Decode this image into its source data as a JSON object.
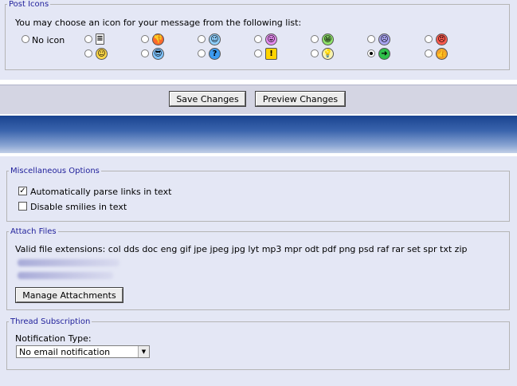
{
  "post_icons": {
    "legend": "Post Icons",
    "prompt": "You may choose an icon for your message from the following list:",
    "no_icon_label": "No icon",
    "icons": [
      {
        "name": "page-icon",
        "glyph": "≡",
        "color": "#f4f4f4"
      },
      {
        "name": "thumbs-down-icon",
        "glyph": "👎",
        "color": "#ff6a2b"
      },
      {
        "name": "wink-icon",
        "glyph": "😉",
        "color": "#8fd0ff"
      },
      {
        "name": "tongue-out-icon",
        "glyph": "😛",
        "color": "#e58bf0"
      },
      {
        "name": "grin-icon",
        "glyph": "😁",
        "color": "#8fe36a"
      },
      {
        "name": "frown-icon",
        "glyph": "☹",
        "color": "#a9a4f2"
      },
      {
        "name": "angry-icon",
        "glyph": "😠",
        "color": "#ff5b4f"
      },
      {
        "name": "smile-icon",
        "glyph": "☺",
        "color": "#ffd84a"
      },
      {
        "name": "cool-icon",
        "glyph": "😎",
        "color": "#7fc3ff"
      },
      {
        "name": "question-icon",
        "glyph": "?",
        "color": "#3c9bf0"
      },
      {
        "name": "warning-icon",
        "glyph": "!",
        "color": "#ffd400"
      },
      {
        "name": "lightbulb-icon",
        "glyph": "💡",
        "color": "#f8f3b0"
      },
      {
        "name": "arrow-right-icon",
        "glyph": "➜",
        "color": "#2fc04a"
      },
      {
        "name": "thumbs-up-icon",
        "glyph": "👍",
        "color": "#f3a32d"
      }
    ],
    "selected": "arrow-right-icon"
  },
  "actions": {
    "save_label": "Save Changes",
    "preview_label": "Preview Changes"
  },
  "misc": {
    "legend": "Miscellaneous Options",
    "parse_links_label": "Automatically parse links in text",
    "parse_links_checked": true,
    "disable_smilies_label": "Disable smilies in text",
    "disable_smilies_checked": false
  },
  "attach": {
    "legend": "Attach Files",
    "valid_ext": "Valid file extensions: col dds doc eng gif jpe jpeg jpg lyt mp3 mpr odt pdf png psd raf rar set spr txt zip",
    "manage_label": "Manage Attachments"
  },
  "subscription": {
    "legend": "Thread Subscription",
    "type_label": "Notification Type:",
    "selected_option": "No email notification"
  },
  "colors": {
    "panel_bg": "#e4e7f5",
    "header_band_top": "#1b4a94",
    "header_band_bottom": "#b9c8e4",
    "legend_text": "#22229c"
  }
}
